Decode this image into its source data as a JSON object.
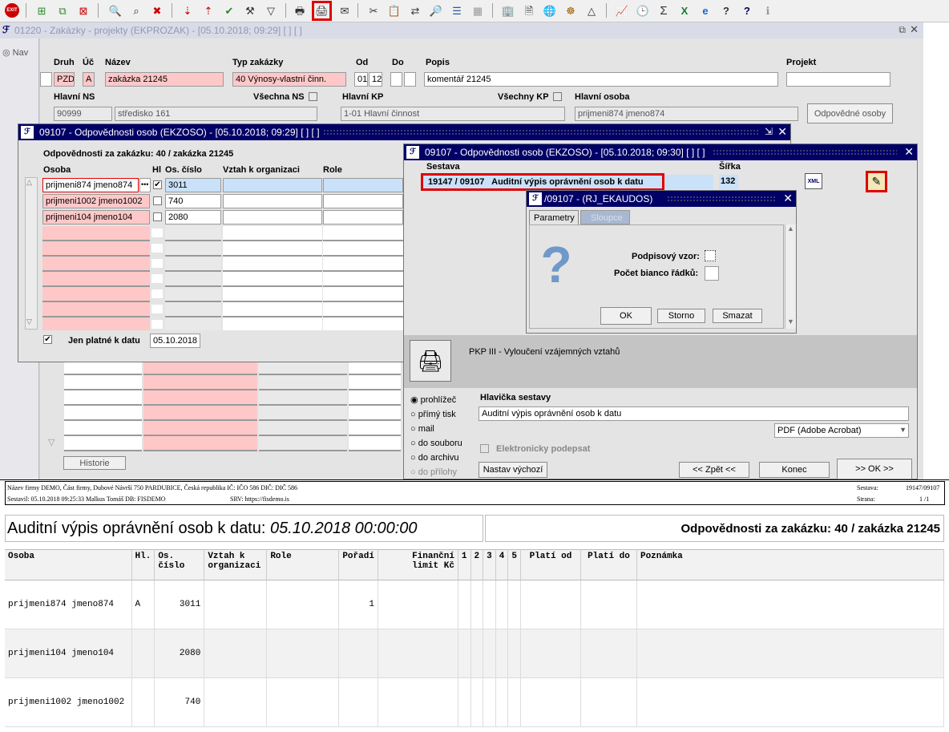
{
  "toolbar": {
    "exit_label": "EXIT"
  },
  "main_window": {
    "title": "01220 - Zakázky - projekty (EKPROZAK) - [05.10.2018; 09:29]  [ ]  [ ]",
    "nav_label": "Nav"
  },
  "form": {
    "druh_label": "Druh",
    "druh_value": "PZD",
    "uc_label": "Úč",
    "uc_value": "A",
    "nazev_label": "Název",
    "nazev_value": "zakázka 21245",
    "typ_label": "Typ zakázky",
    "typ_value": "40 Výnosy-vlastní činn.",
    "od_label": "Od",
    "od_value1": "01",
    "od_value2": "12",
    "do_label": "Do",
    "popis_label": "Popis",
    "popis_value": "komentář 21245",
    "projekt_label": "Projekt",
    "hlavni_ns_label": "Hlavní NS",
    "hlavni_ns_code": "90999",
    "hlavni_ns_name": "středisko 161",
    "vsechna_ns_label": "Všechna NS",
    "hlavni_kp_label": "Hlavní KP",
    "hlavni_kp_value": "1-01 Hlavní činnost",
    "vsechny_kp_label": "Všechny KP",
    "hlavni_osoba_label": "Hlavní osoba",
    "hlavni_osoba_value": "prijmeni874 jmeno874",
    "odpovedne_button": "Odpovědné osoby",
    "historie_button": "Historie"
  },
  "ekzoso1": {
    "title": "09107 - Odpovědnosti osob (EKZOSO) - [05.10.2018; 09:29]  [ ]  [ ]",
    "subtitle": "Odpovědnosti za zakázku: 40 / zakázka 21245",
    "col_osoba": "Osoba",
    "col_hl": "Hl",
    "col_cislo": "Os. číslo",
    "col_vztah": "Vztah k organizaci",
    "col_role": "Role",
    "rows": [
      {
        "osoba": "prijmeni874 jmeno874",
        "hl": "✔",
        "cislo": "3011"
      },
      {
        "osoba": "prijmeni1002 jmeno1002",
        "hl": "",
        "cislo": "740"
      },
      {
        "osoba": "prijmeni104 jmeno104",
        "hl": "",
        "cislo": "2080"
      }
    ],
    "jen_platne_label": "Jen platné k datu",
    "jen_platne_date": "05.10.2018"
  },
  "ekzoso2": {
    "title": "09107 - Odpovědnosti osob (EKZOSO) - [05.10.2018; 09:30]  [ ]  [ ]",
    "sestava_label": "Sestava",
    "sestava_code": "19147",
    "sestava_sub": "/ 09107",
    "sestava_name": "Auditní výpis oprávnění osob k datu",
    "sirka_label": "Šířka",
    "sirka_value": "132",
    "xml_label": "XML",
    "pkp_text": "PKP III - Vyloučení vzájemných vztahů",
    "radio": [
      "prohlížeč",
      "přímý tisk",
      "mail",
      "do souboru",
      "do archivu",
      "do přílohy"
    ],
    "hlavicka_label": "Hlavička sestavy",
    "hlavicka_value": "Auditní výpis oprávnění osob k datu",
    "format_value": "PDF (Adobe Acrobat)",
    "el_podpis_label": "Elektronicky podepsat",
    "nastav_button": "Nastav výchozí",
    "zpet_button": "<< Zpět <<",
    "konec_button": "Konec",
    "ok_button": ">> OK >>"
  },
  "ekaudos": {
    "title": "/09107 - (RJ_EKAUDOS)",
    "tab_parametry": "Parametry",
    "tab_sloupce": "Sloupce",
    "podpisovy_label": "Podpisový vzor:",
    "pocet_label": "Počet bianco řádků:",
    "ok_button": "OK",
    "storno_button": "Storno",
    "smazat_button": "Smazat"
  },
  "report": {
    "header_left1": "Název firmy DEMO, Část firmy, Dubové Návrší 750 PARDUBICE, Česká republika  IČ: IČO 586  DIČ: DIČ 586",
    "header_left2": "Sestavil: 05.10.2018 09:25:33 Malkus Tomáš  DB: FISDEMO",
    "header_srv": "SRV: https://fisdemo.is",
    "sestava_label": "Sestava:",
    "sestava_value": "19147/09107",
    "strana_label": "Strana:",
    "strana_value": "1 /1",
    "title_main": "Auditní výpis oprávnění osob k datu: ",
    "title_date": "05.10.2018 00:00:00",
    "title_right": "Odpovědnosti za zakázku: 40 / zakázka 21245",
    "columns": [
      "Osoba",
      "Hl.",
      "Os. číslo",
      "Vztah k organizaci",
      "Role",
      "Pořadí",
      "Finanční limit Kč",
      "1",
      "2",
      "3",
      "4",
      "5",
      "Platí od",
      "Platí do",
      "Poznámka"
    ],
    "rows": [
      {
        "osoba": "prijmeni874 jmeno874",
        "hl": "A",
        "cislo": "3011",
        "poradi": "1"
      },
      {
        "osoba": "prijmeni104 jmeno104",
        "hl": "",
        "cislo": "2080",
        "poradi": ""
      },
      {
        "osoba": "prijmeni1002 jmeno1002",
        "hl": "",
        "cislo": "740",
        "poradi": ""
      }
    ]
  }
}
